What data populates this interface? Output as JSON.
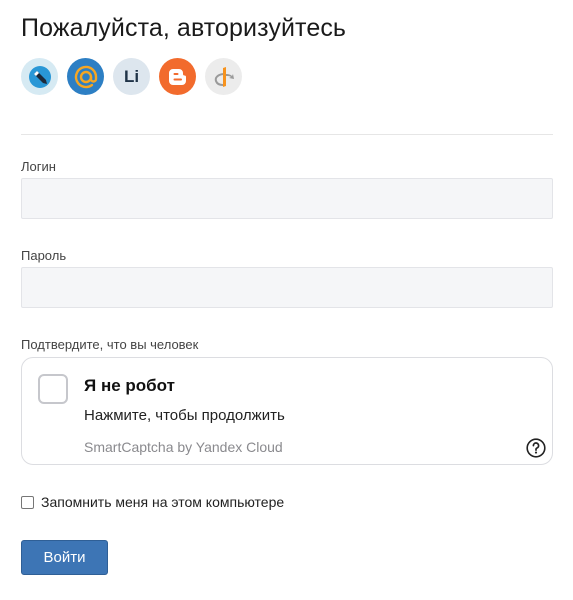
{
  "page_title": "Пожалуйста, авторизуйтесь",
  "providers": [
    {
      "icon": "livejournal-icon",
      "bg": "#d6eaf3",
      "accent": "#2997d6"
    },
    {
      "icon": "mailru-icon",
      "bg": "#2d7fc4",
      "accent": "#f5a623"
    },
    {
      "icon": "liveinternet-icon",
      "label": "Li",
      "bg": "#dde6ee"
    },
    {
      "icon": "blogger-icon",
      "bg": "#f26b2d"
    },
    {
      "icon": "openid-icon",
      "bg": "#ececec",
      "accent": "#f7931e"
    }
  ],
  "login": {
    "label": "Логин",
    "value": "",
    "placeholder": ""
  },
  "password": {
    "label": "Пароль",
    "value": "",
    "placeholder": ""
  },
  "captcha": {
    "label": "Подтвердите, что вы человек",
    "title": "Я не робот",
    "subtitle": "Нажмите, чтобы продолжить",
    "brand": "SmartCaptcha by Yandex Cloud"
  },
  "remember": {
    "label": "Запомнить меня на этом компьютере",
    "checked": false
  },
  "submit_label": "Войти",
  "colors": {
    "primary_button": "#3d75b5",
    "input_bg": "#f5f6f8"
  }
}
